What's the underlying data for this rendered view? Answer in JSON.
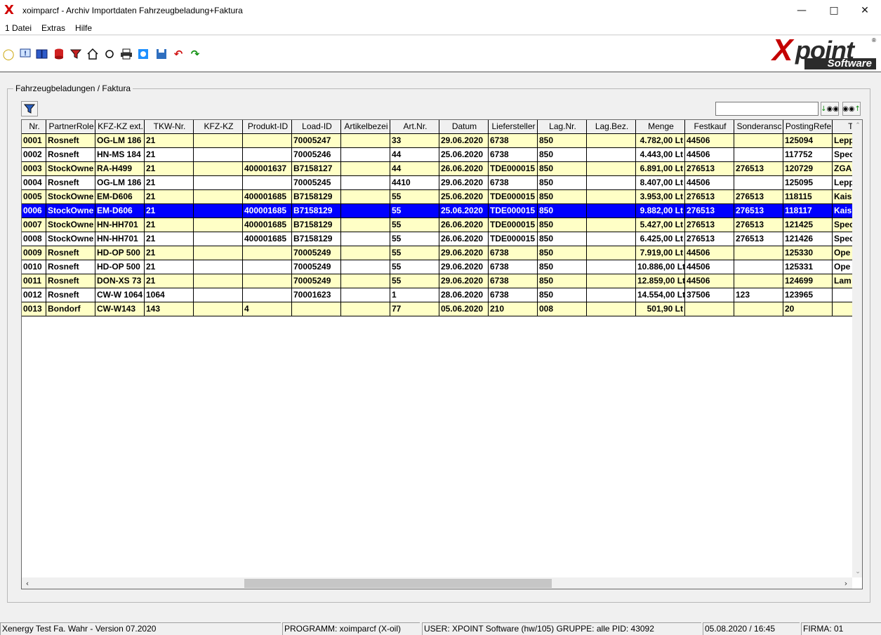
{
  "window": {
    "title": "xoimparcf - Archiv Importdaten Fahrzeugbeladung+Faktura",
    "logo": "X"
  },
  "menu": [
    "1 Datei",
    "Extras",
    "Hilfe"
  ],
  "toolbar_icons": [
    "lightbulb-icon",
    "info-icon",
    "book-icon",
    "database-icon",
    "filter-icon",
    "home-icon",
    "refresh-icon",
    "print-icon",
    "chat-icon",
    "save-icon",
    "undo-icon",
    "redo-icon"
  ],
  "brand": {
    "big": "X",
    "word": "point",
    "sub": "Software",
    "reg": "®"
  },
  "group": {
    "title": "Fahrzeugbeladungen / Faktura"
  },
  "search": {
    "value": ""
  },
  "table": {
    "columns": [
      "Nr.",
      "PartnerRole",
      "KFZ-KZ ext.",
      "TKW-Nr.",
      "KFZ-KZ",
      "Produkt-ID",
      "Load-ID",
      "Artikelbezei",
      "Art.Nr.",
      "Datum",
      "Liefersteller",
      "Lag.Nr.",
      "Lag.Bez.",
      "Menge",
      "Festkauf",
      "Sonderansc",
      "PostingRefe",
      "TKW"
    ],
    "rows": [
      {
        "style": "yellow",
        "cells": [
          "0001",
          "Rosneft",
          "OG-LM 186",
          "21",
          "",
          "",
          "70005247",
          "",
          "33",
          "29.06.2020",
          "6738",
          "850",
          "",
          "4.782,00  Lt",
          "44506",
          "",
          "125094",
          "Lepp"
        ]
      },
      {
        "style": "white",
        "cells": [
          "0002",
          "Rosneft",
          "HN-MS 184",
          "21",
          "",
          "",
          "70005246",
          "",
          "44",
          "25.06.2020",
          "6738",
          "850",
          "",
          "4.443,00  Lt",
          "44506",
          "",
          "117752",
          "Spec"
        ]
      },
      {
        "style": "yellow",
        "cells": [
          "0003",
          "StockOwne",
          "RA-H499",
          "21",
          "",
          "400001637",
          "B7158127",
          "",
          "44",
          "26.06.2020",
          "TDE000015",
          "850",
          "",
          "6.891,00  Lt",
          "276513",
          "276513",
          "120729",
          "ZGA"
        ]
      },
      {
        "style": "white",
        "cells": [
          "0004",
          "Rosneft",
          "OG-LM 186",
          "21",
          "",
          "",
          "70005245",
          "",
          "4410",
          "29.06.2020",
          "6738",
          "850",
          "",
          "8.407,00  Lt",
          "44506",
          "",
          "125095",
          "Lepp"
        ]
      },
      {
        "style": "yellow",
        "cells": [
          "0005",
          "StockOwne",
          "EM-D606",
          "21",
          "",
          "400001685",
          "B7158129",
          "",
          "55",
          "25.06.2020",
          "TDE000015",
          "850",
          "",
          "3.953,00  Lt",
          "276513",
          "276513",
          "118115",
          "Kais"
        ]
      },
      {
        "style": "selected",
        "cells": [
          "0006",
          "StockOwne",
          "EM-D606",
          "21",
          "",
          "400001685",
          "B7158129",
          "",
          "55",
          "25.06.2020",
          "TDE000015",
          "850",
          "",
          "9.882,00  Lt",
          "276513",
          "276513",
          "118117",
          "Kais"
        ]
      },
      {
        "style": "yellow",
        "cells": [
          "0007",
          "StockOwne",
          "HN-HH701",
          "21",
          "",
          "400001685",
          "B7158129",
          "",
          "55",
          "26.06.2020",
          "TDE000015",
          "850",
          "",
          "5.427,00  Lt",
          "276513",
          "276513",
          "121425",
          "Spec"
        ]
      },
      {
        "style": "white",
        "cells": [
          "0008",
          "StockOwne",
          "HN-HH701",
          "21",
          "",
          "400001685",
          "B7158129",
          "",
          "55",
          "26.06.2020",
          "TDE000015",
          "850",
          "",
          "6.425,00  Lt",
          "276513",
          "276513",
          "121426",
          "Spec"
        ]
      },
      {
        "style": "yellow",
        "cells": [
          "0009",
          "Rosneft",
          "HD-OP 500",
          "21",
          "",
          "",
          "70005249",
          "",
          "55",
          "29.06.2020",
          "6738",
          "850",
          "",
          "7.919,00  Lt",
          "44506",
          "",
          "125330",
          "Ope"
        ]
      },
      {
        "style": "white",
        "cells": [
          "0010",
          "Rosneft",
          "HD-OP 500",
          "21",
          "",
          "",
          "70005249",
          "",
          "55",
          "29.06.2020",
          "6738",
          "850",
          "",
          "10.886,00  Lt",
          "44506",
          "",
          "125331",
          "Ope"
        ]
      },
      {
        "style": "yellow",
        "cells": [
          "0011",
          "Rosneft",
          "DON-XS 73",
          "21",
          "",
          "",
          "70005249",
          "",
          "55",
          "29.06.2020",
          "6738",
          "850",
          "",
          "12.859,00  Lt",
          "44506",
          "",
          "124699",
          "Lam"
        ]
      },
      {
        "style": "white",
        "cells": [
          "0012",
          "Rosneft",
          "CW-W 1064",
          "1064",
          "",
          "",
          "70001623",
          "",
          "1",
          "28.06.2020",
          "6738",
          "850",
          "",
          "14.554,00  Lt",
          "37506",
          "123",
          "123965",
          ""
        ]
      },
      {
        "style": "yellow",
        "cells": [
          "0013",
          "Bondorf",
          "CW-W143",
          "143",
          "",
          "4",
          "",
          "",
          "77",
          "05.06.2020",
          "210",
          "008",
          "",
          "501,90  Lt",
          "",
          "",
          "20",
          ""
        ]
      }
    ]
  },
  "status": {
    "version": "Xenergy Test Fa. Wahr - Version 07.2020",
    "program": "PROGRAMM: xoimparcf (X-oil)",
    "user": "USER: XPOINT Software (hw/105)  GRUPPE: alle  PID: 43092",
    "datetime": "05.08.2020 / 16:45",
    "firma": "FIRMA: 01"
  }
}
